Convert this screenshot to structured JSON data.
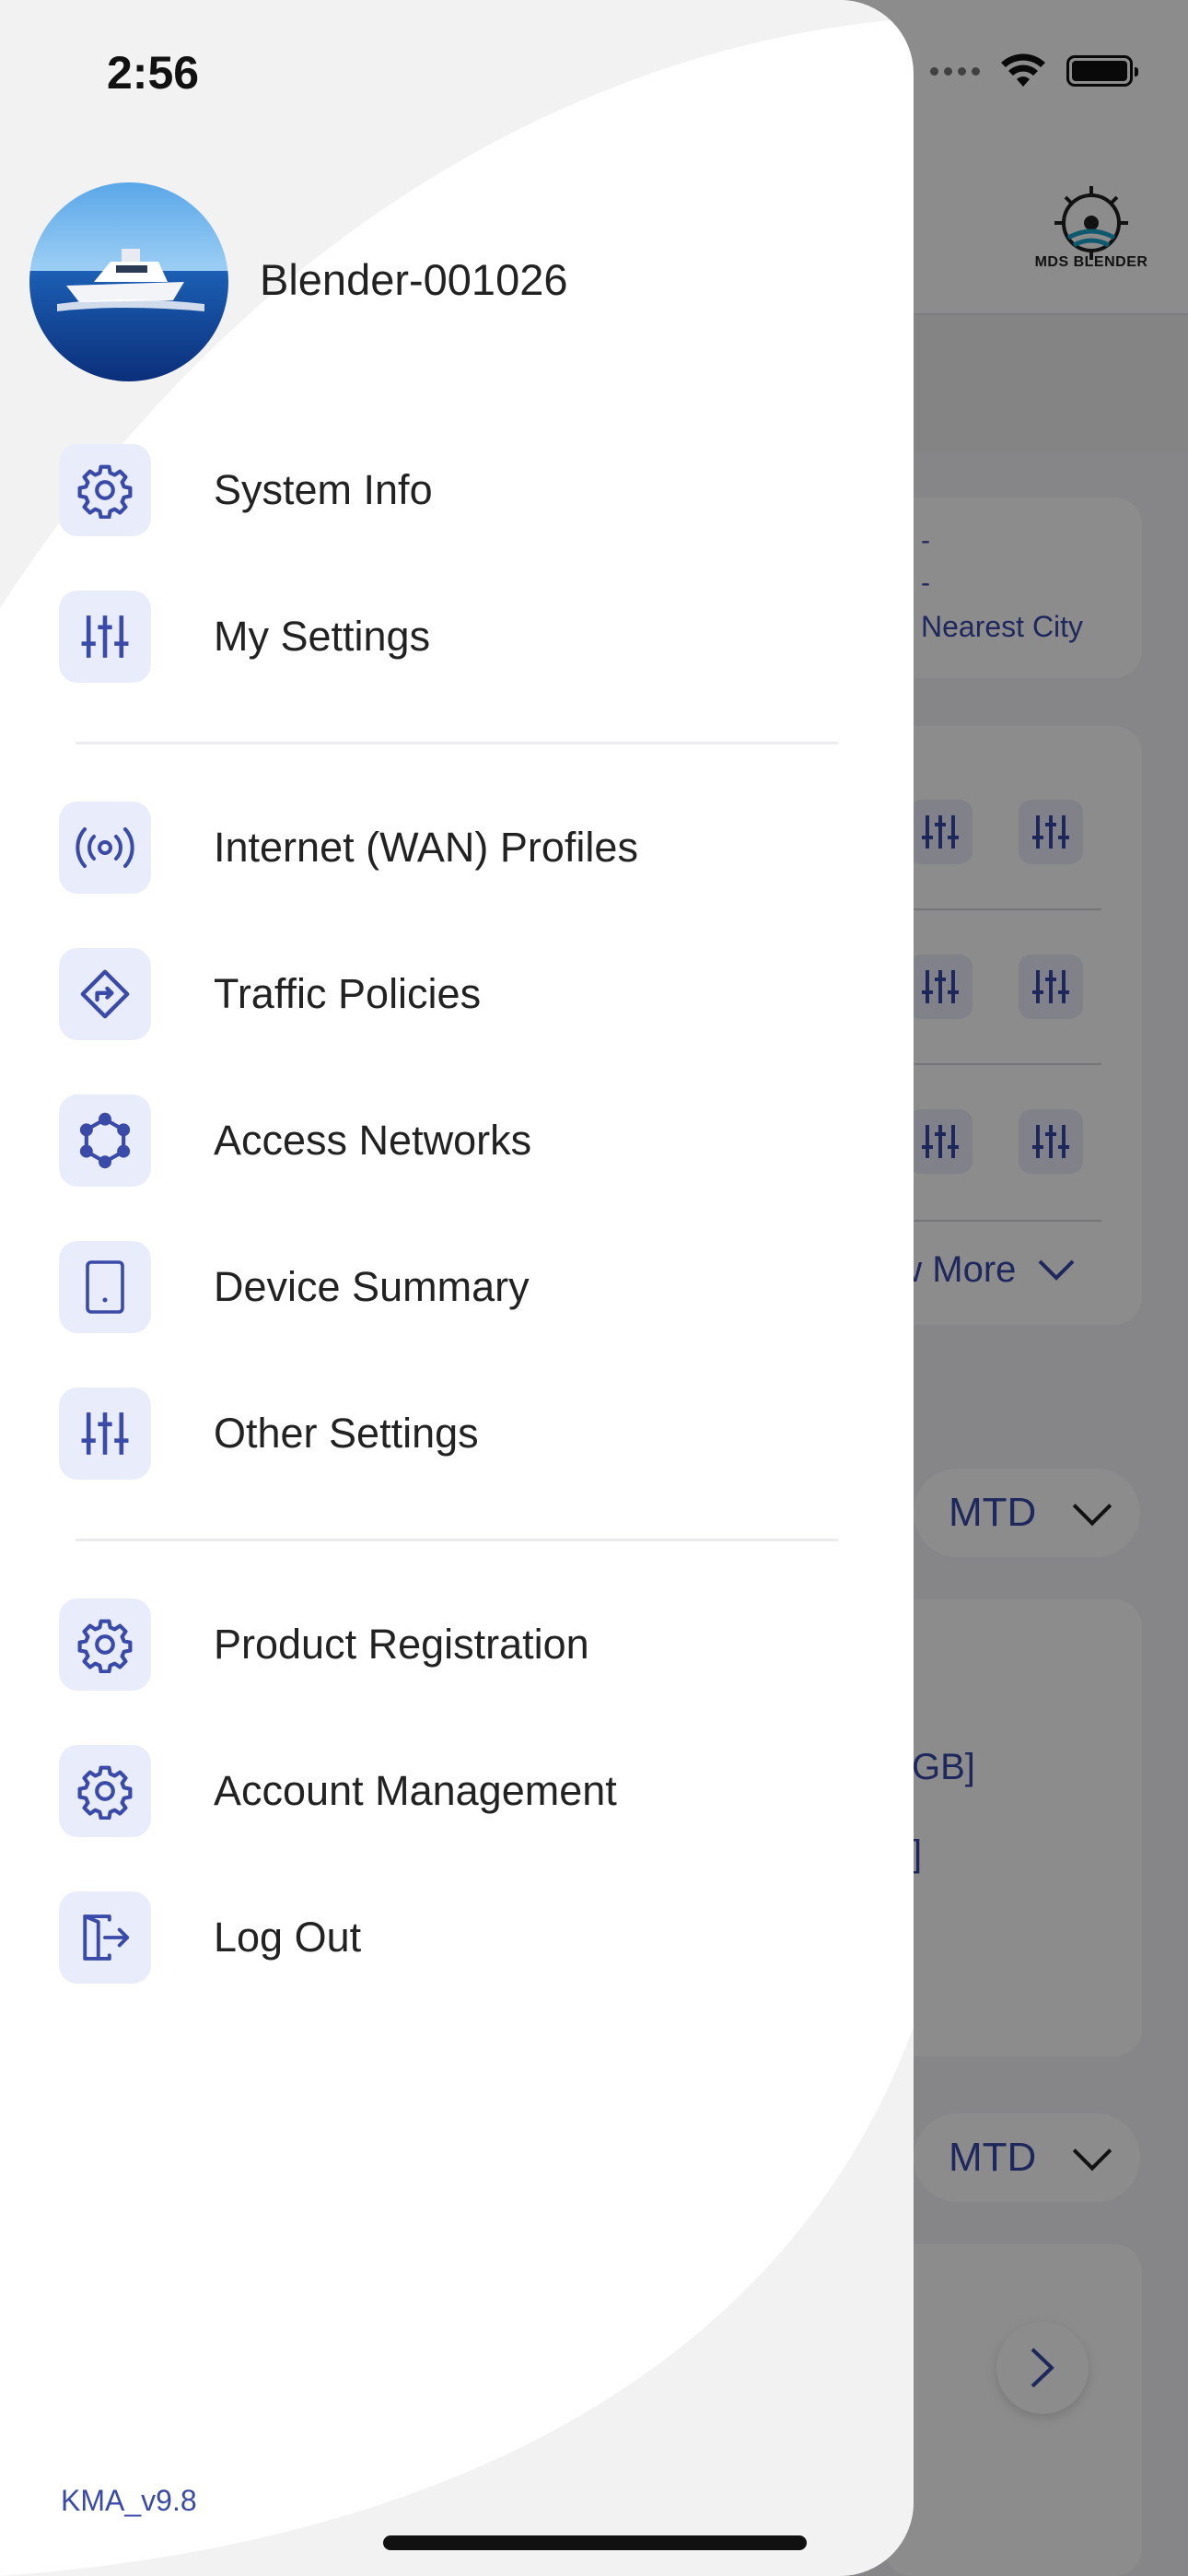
{
  "status_bar": {
    "time": "2:56"
  },
  "background_app": {
    "logo_text": "MDS BLENDER",
    "location_dash_1": "-",
    "location_dash_2": "-",
    "nearest_city": "Nearest City",
    "view_more": "ew More",
    "period_select_1": "MTD",
    "period_select_2": "MTD",
    "usage_fragment_1": "GB]",
    "usage_fragment_2": "]"
  },
  "drawer": {
    "profile_name": "Blender-001026",
    "sections": [
      {
        "items": [
          {
            "label": "System Info",
            "icon": "gear-icon"
          },
          {
            "label": "My Settings",
            "icon": "sliders-icon"
          }
        ]
      },
      {
        "items": [
          {
            "label": "Internet (WAN) Profiles",
            "icon": "broadcast-icon"
          },
          {
            "label": "Traffic Policies",
            "icon": "route-diamond-icon"
          },
          {
            "label": "Access Networks",
            "icon": "network-hexagon-icon"
          },
          {
            "label": "Device Summary",
            "icon": "tablet-icon"
          },
          {
            "label": "Other Settings",
            "icon": "sliders-icon"
          }
        ]
      },
      {
        "items": [
          {
            "label": "Product Registration",
            "icon": "gear-icon"
          },
          {
            "label": "Account Management",
            "icon": "gear-icon"
          },
          {
            "label": "Log Out",
            "icon": "logout-icon"
          }
        ]
      }
    ],
    "version": "KMA_v9.8"
  },
  "colors": {
    "accent": "#3a4aa8",
    "icon_bg": "#e9ecfb",
    "text": "#222222",
    "overlay": "rgba(0,0,0,0.45)"
  }
}
